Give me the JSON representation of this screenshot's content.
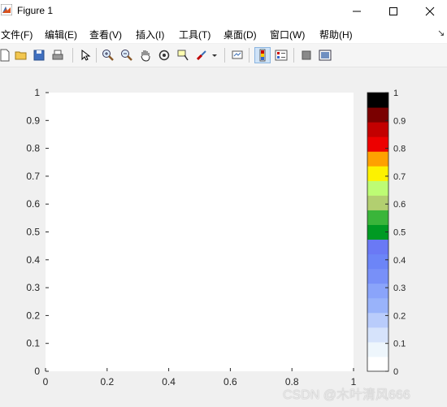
{
  "window": {
    "title": "Figure 1"
  },
  "menu": [
    {
      "id": "file",
      "label": "文件(F)"
    },
    {
      "id": "edit",
      "label": "编辑(E)"
    },
    {
      "id": "view",
      "label": "查看(V)"
    },
    {
      "id": "insert",
      "label": "插入(I)"
    },
    {
      "id": "tools",
      "label": "工具(T)"
    },
    {
      "id": "desktop",
      "label": "桌面(D)"
    },
    {
      "id": "window",
      "label": "窗口(W)"
    },
    {
      "id": "help",
      "label": "帮助(H)"
    }
  ],
  "toolbar": {
    "icons": [
      "new-file-icon",
      "open-folder-icon",
      "save-icon",
      "print-icon",
      "pointer-icon",
      "zoom-in-icon",
      "zoom-out-icon",
      "pan-hand-icon",
      "rotate-3d-icon",
      "data-cursor-icon",
      "brush-icon",
      "link-plot-icon",
      "colorbar-icon",
      "legend-icon",
      "hide-plot-tools-icon",
      "show-plot-tools-icon"
    ]
  },
  "chart_data": {
    "type": "heatmap",
    "title": "",
    "xlabel": "",
    "ylabel": "",
    "xlim": [
      0,
      1
    ],
    "ylim": [
      0,
      1
    ],
    "xticks": [
      "0",
      "0.2",
      "0.4",
      "0.6",
      "0.8",
      "1"
    ],
    "yticks": [
      "0",
      "0.1",
      "0.2",
      "0.3",
      "0.4",
      "0.5",
      "0.6",
      "0.7",
      "0.8",
      "0.9",
      "1"
    ],
    "grid": false,
    "colorbar": {
      "location": "right",
      "limits": [
        0,
        1
      ],
      "ticks": [
        "0",
        "0.1",
        "0.2",
        "0.3",
        "0.4",
        "0.5",
        "0.6",
        "0.7",
        "0.8",
        "0.9",
        "1"
      ],
      "colormap": [
        "#ffffff",
        "#eef6fc",
        "#d6e3fb",
        "#b9ccfb",
        "#99b3fa",
        "#8aa4fa",
        "#7890f8",
        "#6c85f7",
        "#6a79f5",
        "#009a23",
        "#3ab53a",
        "#b2cf70",
        "#bdfc74",
        "#fdf200",
        "#fea100",
        "#ed0000",
        "#c30000",
        "#7a0000",
        "#000000"
      ]
    }
  },
  "watermark": "CSDN @木叶清风666"
}
